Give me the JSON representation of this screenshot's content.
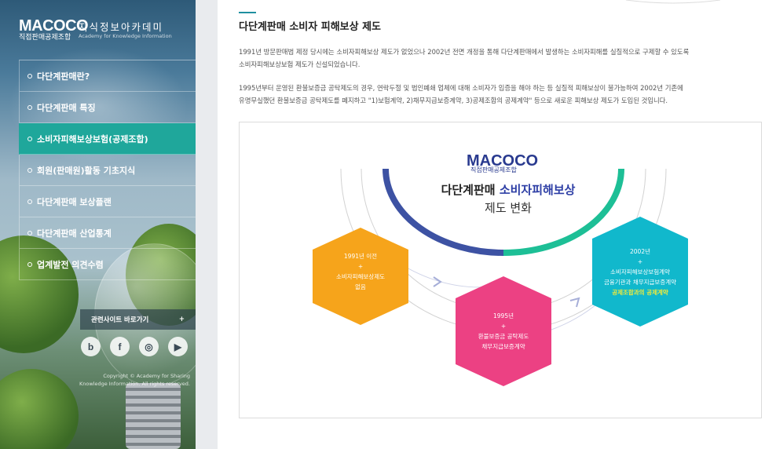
{
  "sidebar": {
    "logo_mark": "MACOCO",
    "logo_sub": "직접판매공제조합",
    "logo_kor": "지식정보아카데미",
    "logo_eng": "Academy for Knowledge Information",
    "menu": [
      {
        "label": "다단계판매란?"
      },
      {
        "label": "다단계판매 특징"
      },
      {
        "label": "소비자피해보상보험(공제조합)"
      },
      {
        "label": "회원(판매원)활동 기초지식"
      },
      {
        "label": "다단계판매 보상플랜"
      },
      {
        "label": "다단계판매 산업통계"
      },
      {
        "label": "업계발전 의견수렴"
      }
    ],
    "active_index": 2,
    "related_label": "관련사이트 바로가기",
    "related_plus": "+",
    "social": [
      {
        "icon": "blog-icon",
        "glyph": "b"
      },
      {
        "icon": "facebook-icon",
        "glyph": "f"
      },
      {
        "icon": "instagram-icon",
        "glyph": "◎"
      },
      {
        "icon": "youtube-icon",
        "glyph": "▶"
      }
    ],
    "copyright_line1": "Copyright © Academy for Sharing",
    "copyright_line2": "Knowledge Information. All rights reserved."
  },
  "main": {
    "title": "다단계판매 소비자 피해보상 제도",
    "para1_line1": "1991년 방문판매법 제정 당시에는 소비자피해보상 제도가 없었으나 2002년 전면 개정을 통해 다단계판매에서 발생하는 소비자피해를 실질적으로 구제할 수 있도록",
    "para1_line2": "소비자피해보상보험 제도가 신설되었습니다.",
    "para2_line1": "1995년부터 운영된 환불보증금 공탁제도의 경우, 연락두절 및 법인폐쇄 업체에 대해 소비자가 입증을 해야 하는 등 실질적 피해보상이 불가능하여 2002년 기존에",
    "para2_line2": "유명무실했던 환불보증금 공탁제도를 폐지하고 \"1)보험계약, 2)채무지급보증계약, 3)공제조합의 공제계약\" 등으로 새로운 피해보상 제도가 도입된 것입니다."
  },
  "diagram": {
    "logo_mark": "MACOCO",
    "logo_sub": "직접판매공제조합",
    "title_plain": "다단계판매 ",
    "title_accent": "소비자피해보상",
    "subtitle": "제도 변화",
    "hex1": {
      "year": "1991년 이전",
      "plus": "+",
      "line1": "소비자피해보상제도",
      "line2": "없음"
    },
    "hex2": {
      "year": "1995년",
      "plus": "+",
      "line1": "환불보증금 공탁제도",
      "line2": "채무지급보증계약"
    },
    "hex3": {
      "year": "2002년",
      "plus": "+",
      "line1": "소비자피해보상보험계약",
      "line2": "금융기관과 채무지급보증계약",
      "line3": "공제조합과의 공제계약"
    },
    "colors": {
      "orange": "#f6a41b",
      "pink": "#ec4183",
      "teal": "#11b8cc",
      "navy": "#3d52a3",
      "green": "#1dbf96",
      "active": "#1fa79b"
    }
  }
}
